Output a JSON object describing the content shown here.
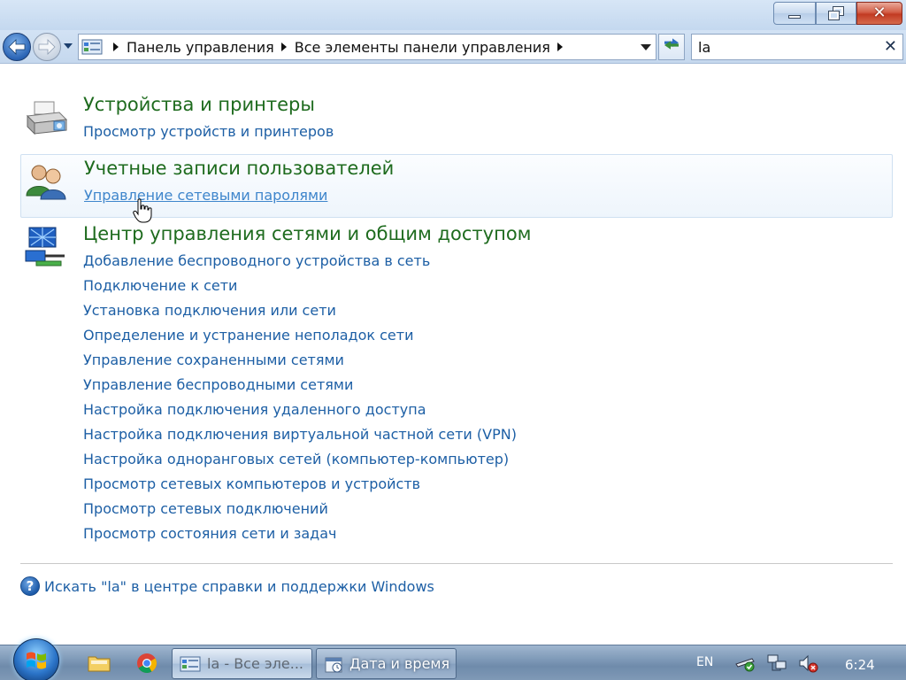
{
  "window": {
    "minimize_icon": "minimize-icon",
    "maximize_icon": "restore-icon",
    "close_icon": "close-icon"
  },
  "nav": {
    "back_icon": "back-arrow-icon",
    "forward_icon": "forward-arrow-icon",
    "breadcrumb": [
      "Панель управления",
      "Все элементы панели управления"
    ],
    "search_value": "la"
  },
  "groups": [
    {
      "title": "Устройства и принтеры",
      "icon": "printer-icon",
      "links": [
        "Просмотр устройств и принтеров"
      ]
    },
    {
      "title": "Учетные записи пользователей",
      "icon": "user-accounts-icon",
      "links": [
        "Управление сетевыми паролями"
      ]
    },
    {
      "title": "Центр управления сетями и общим доступом",
      "icon": "network-center-icon",
      "links": [
        "Добавление беспроводного устройства в сеть",
        "Подключение к сети",
        "Установка подключения или сети",
        "Определение и устранение неполадок сети",
        "Управление сохраненными сетями",
        "Управление беспроводными сетями",
        "Настройка подключения удаленного доступа",
        "Настройка подключения виртуальной частной сети (VPN)",
        "Настройка одноранговых сетей (компьютер-компьютер)",
        "Просмотр сетевых компьютеров и устройств",
        "Просмотр сетевых подключений",
        "Просмотр состояния сети и задач"
      ]
    }
  ],
  "help": {
    "text": "Искать \"la\" в центре справки и поддержки Windows",
    "icon": "help-icon",
    "glyph": "?"
  },
  "taskbar": {
    "tasks": [
      {
        "label": "la - Все эле...",
        "icon": "control-panel-icon",
        "state": "active"
      },
      {
        "label": "Дата и время",
        "icon": "date-time-icon",
        "state": "inactive"
      }
    ],
    "language": "EN",
    "clock": "6:24"
  },
  "colors": {
    "group_title": "#1e6b1e",
    "link": "#1d5fa5",
    "hover_link": "#3f86cc"
  }
}
